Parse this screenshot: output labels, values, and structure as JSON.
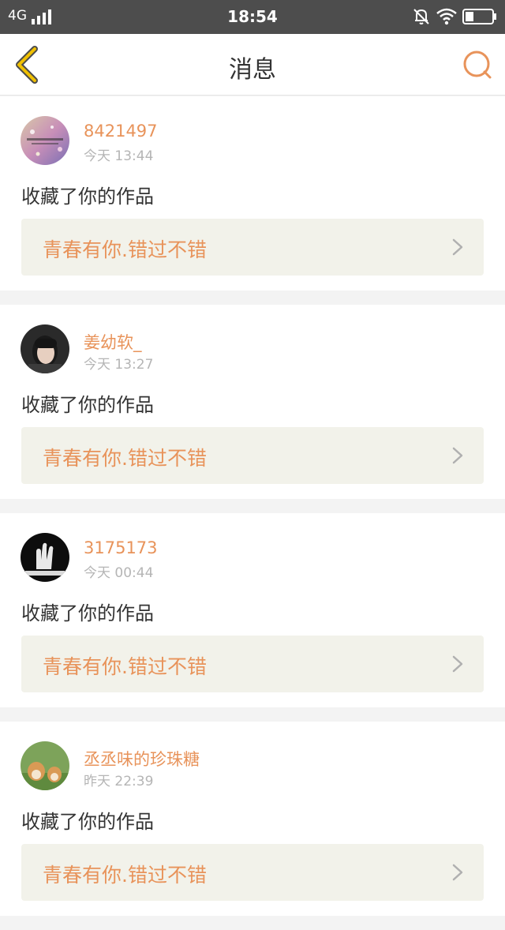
{
  "status_bar": {
    "network": "4G",
    "time": "18:54"
  },
  "nav": {
    "title": "消息",
    "back_icon": "chevron-left-icon",
    "search_icon": "search-icon"
  },
  "colors": {
    "accent": "#e8935a",
    "nav_back": "#f0c000",
    "card_bg": "#ffffff",
    "work_bg": "#f2f2ea"
  },
  "messages": [
    {
      "username": "8421497",
      "time": "今天 13:44",
      "action": "收藏了你的作品",
      "work_title": "青春有你.错过不错"
    },
    {
      "username": "姜幼软_",
      "time": "今天 13:27",
      "action": "收藏了你的作品",
      "work_title": "青春有你.错过不错"
    },
    {
      "username": "3175173",
      "time": "今天 00:44",
      "action": "收藏了你的作品",
      "work_title": "青春有你.错过不错"
    },
    {
      "username": "丞丞味的珍珠糖",
      "time": "昨天 22:39",
      "action": "收藏了你的作品",
      "work_title": "青春有你.错过不错"
    }
  ]
}
